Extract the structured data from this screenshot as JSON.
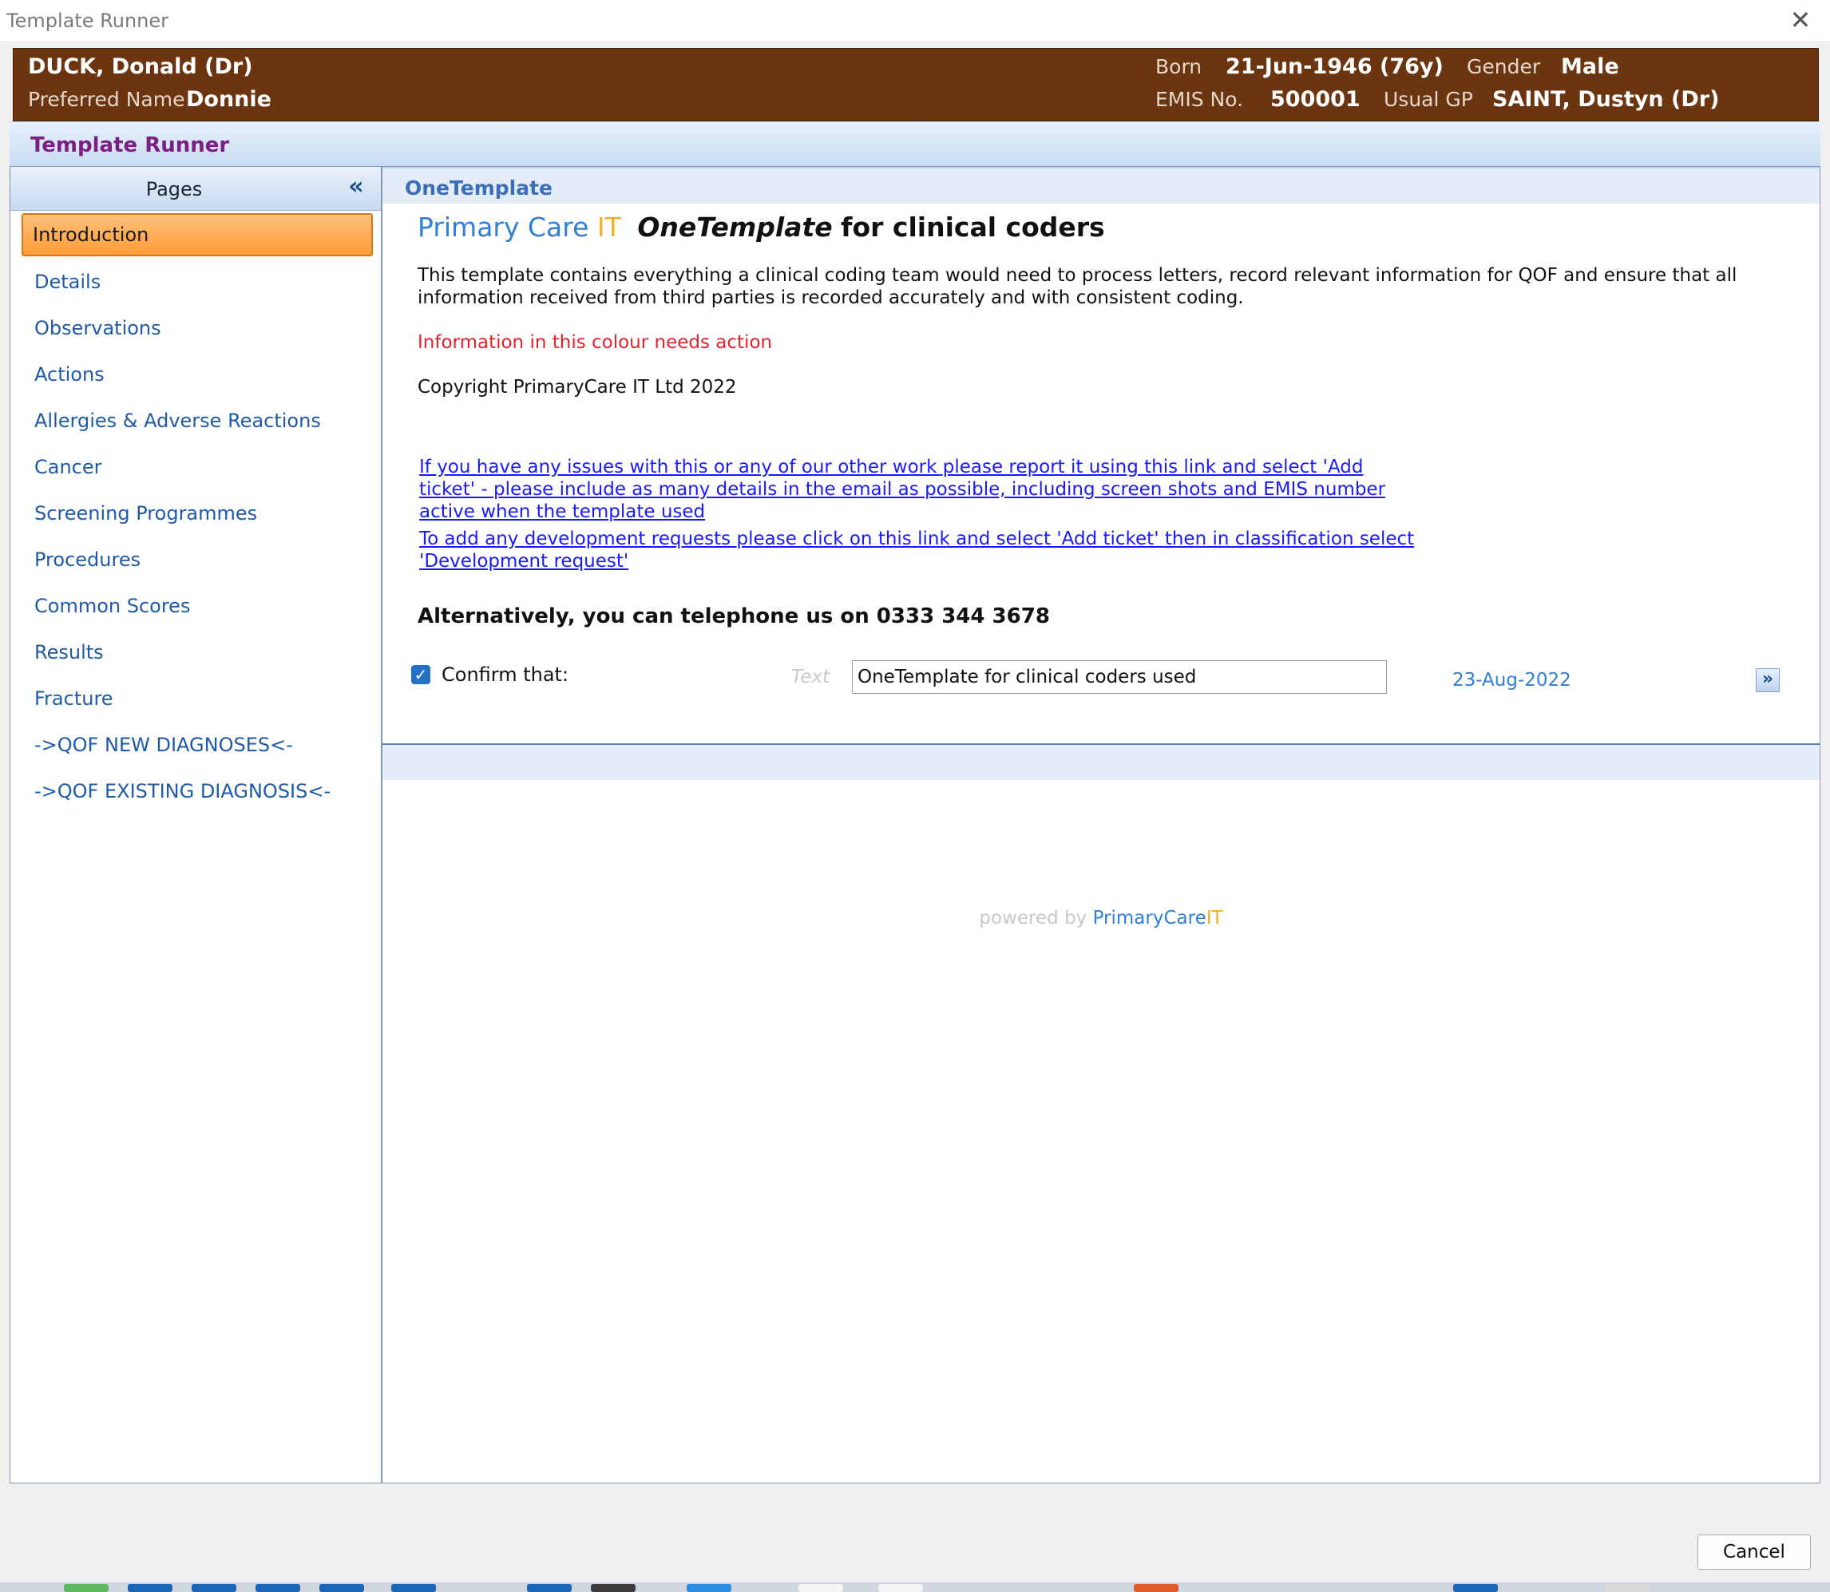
{
  "window": {
    "title": "Template Runner",
    "close_symbol": "✕"
  },
  "patient": {
    "name": "DUCK, Donald (Dr)",
    "preferred_name_label": "Preferred Name",
    "preferred_name": "Donnie",
    "born_label": "Born",
    "born": "21-Jun-1946 (76y)",
    "gender_label": "Gender",
    "gender": "Male",
    "emis_label": "EMIS No.",
    "emis": "500001",
    "gp_label": "Usual GP",
    "gp": "SAINT, Dustyn (Dr)",
    "banner_color": "#6b3510"
  },
  "header": {
    "title": "Template Runner",
    "title_color": "#7b1f82"
  },
  "pages": {
    "title": "Pages",
    "collapse_symbol": "«",
    "active_color": "#ff9d38",
    "items": [
      {
        "label": "Introduction"
      },
      {
        "label": "Details"
      },
      {
        "label": "Observations"
      },
      {
        "label": "Actions"
      },
      {
        "label": "Allergies & Adverse Reactions"
      },
      {
        "label": "Cancer"
      },
      {
        "label": "Screening Programmes"
      },
      {
        "label": "Procedures"
      },
      {
        "label": "Common Scores"
      },
      {
        "label": "Results"
      },
      {
        "label": "Fracture"
      },
      {
        "label": "->QOF NEW DIAGNOSES<-"
      },
      {
        "label": "->QOF EXISTING DIAGNOSIS<-"
      }
    ]
  },
  "content": {
    "section_title": "OneTemplate",
    "heading": {
      "brand1": "Primary Care",
      "brand2": "IT",
      "product": "OneTemplate",
      "rest": "for clinical coders"
    },
    "intro": "This template contains everything a clinical coding team would need to process letters, record relevant information for QOF and ensure that all information received from third parties is recorded accurately and with consistent coding.",
    "action_note": "Information in this colour needs action",
    "copyright": "Copyright PrimaryCare IT Ltd 2022",
    "link1": "If you have any issues with this or any of our other work please report it using this link and select 'Add ticket' - please include as many details in the email as possible, including screen shots and EMIS number active when the template used",
    "link2": "To add any development requests please click on this link and select 'Add ticket' then in classification select 'Development request'",
    "phone": "Alternatively, you can telephone us on 0333 344 3678",
    "confirm": {
      "label": "Confirm that:",
      "checked": true,
      "text_hint": "Text",
      "value": "OneTemplate for clinical coders used",
      "date": "23-Aug-2022",
      "next_symbol": "»"
    },
    "powered": {
      "prefix": "powered by",
      "brand1": "PrimaryCare",
      "brand2": "IT"
    }
  },
  "footer": {
    "cancel_label": "Cancel"
  },
  "colors": {
    "link": "#1a1aff",
    "action": "#e8202a",
    "accent_blue": "#2f7fd6",
    "accent_yellow": "#f2b01e"
  }
}
